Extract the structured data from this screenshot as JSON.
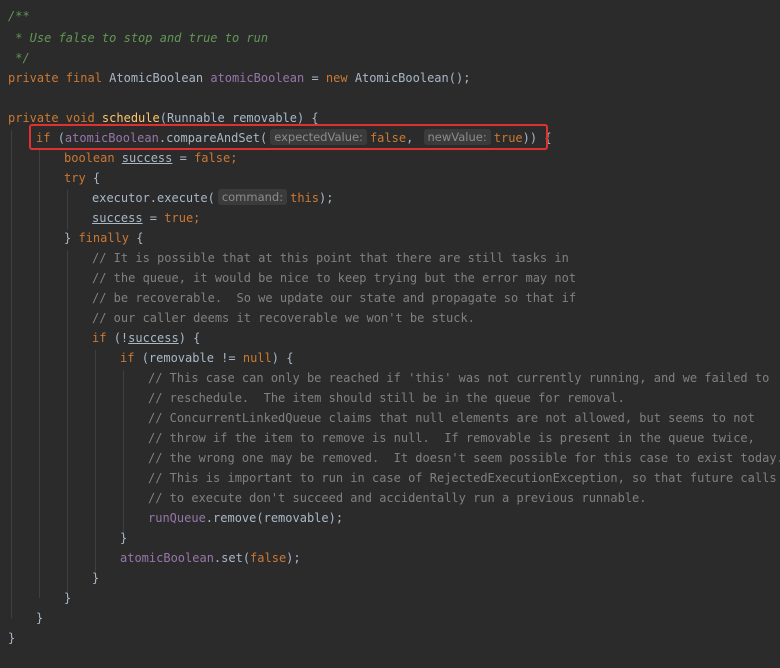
{
  "code": {
    "doc_open": "/**",
    "doc_text": " * Use false to stop and true to run",
    "doc_close": " */",
    "l4_mods": "private final ",
    "l4_type": "AtomicBoolean ",
    "l4_field": "atomicBoolean",
    "l4_eq": " = ",
    "l4_new": "new ",
    "l4_ctor": "AtomicBoolean();",
    "l6_mods": "private void ",
    "l6_name": "schedule",
    "l6_params": "(Runnable removable) {",
    "l7_if": "if ",
    "l7_paren": "(",
    "l7_field": "atomicBoolean",
    "l7_call": ".compareAndSet(",
    "l7_hint1": "expectedValue:",
    "l7_false": "false",
    "l7_comma": ", ",
    "l7_hint2": "newValue:",
    "l7_true": "true",
    "l7_end": ")) {",
    "l8_type": "boolean ",
    "l8_var": "success",
    "l8_eq": " = ",
    "l8_false": "false",
    "l8_semi": ";",
    "l9_try": "try ",
    "l9_brace": "{",
    "l10_call": "executor.execute(",
    "l10_hint": "command:",
    "l10_this": "this",
    "l10_end": ");",
    "l11_var": "success",
    "l11_eq": " = ",
    "l11_true": "true",
    "l11_semi": ";",
    "l12_brace": "} ",
    "l12_finally": "finally ",
    "l12_open": "{",
    "c1": "// It is possible that at this point that there are still tasks in",
    "c2": "// the queue, it would be nice to keep trying but the error may not",
    "c3": "// be recoverable.  So we update our state and propagate so that if",
    "c4": "// our caller deems it recoverable we won't be stuck.",
    "l17_if": "if ",
    "l17_open": "(!",
    "l17_var": "success",
    "l17_close": ") {",
    "l18_if": "if ",
    "l18_cond": "(removable != ",
    "l18_null": "null",
    "l18_close": ") {",
    "c5": "// This case can only be reached if 'this' was not currently running, and we failed to",
    "c6": "// reschedule.  The item should still be in the queue for removal.",
    "c7": "// ConcurrentLinkedQueue claims that null elements are not allowed, but seems to not",
    "c8": "// throw if the item to remove is null.  If removable is present in the queue twice,",
    "c9": "// the wrong one may be removed.  It doesn't seem possible for this case to exist today.",
    "c10": "// This is important to run in case of RejectedExecutionException, so that future calls",
    "c11": "// to execute don't succeed and accidentally run a previous runnable.",
    "l26_field": "runQueue",
    "l26_rest": ".remove(removable);",
    "l27": "}",
    "l28_field": "atomicBoolean",
    "l28_call": ".set(",
    "l28_false": "false",
    "l28_end": ");",
    "l29": "}",
    "l30": "}",
    "l31": "}",
    "l32": "}"
  }
}
